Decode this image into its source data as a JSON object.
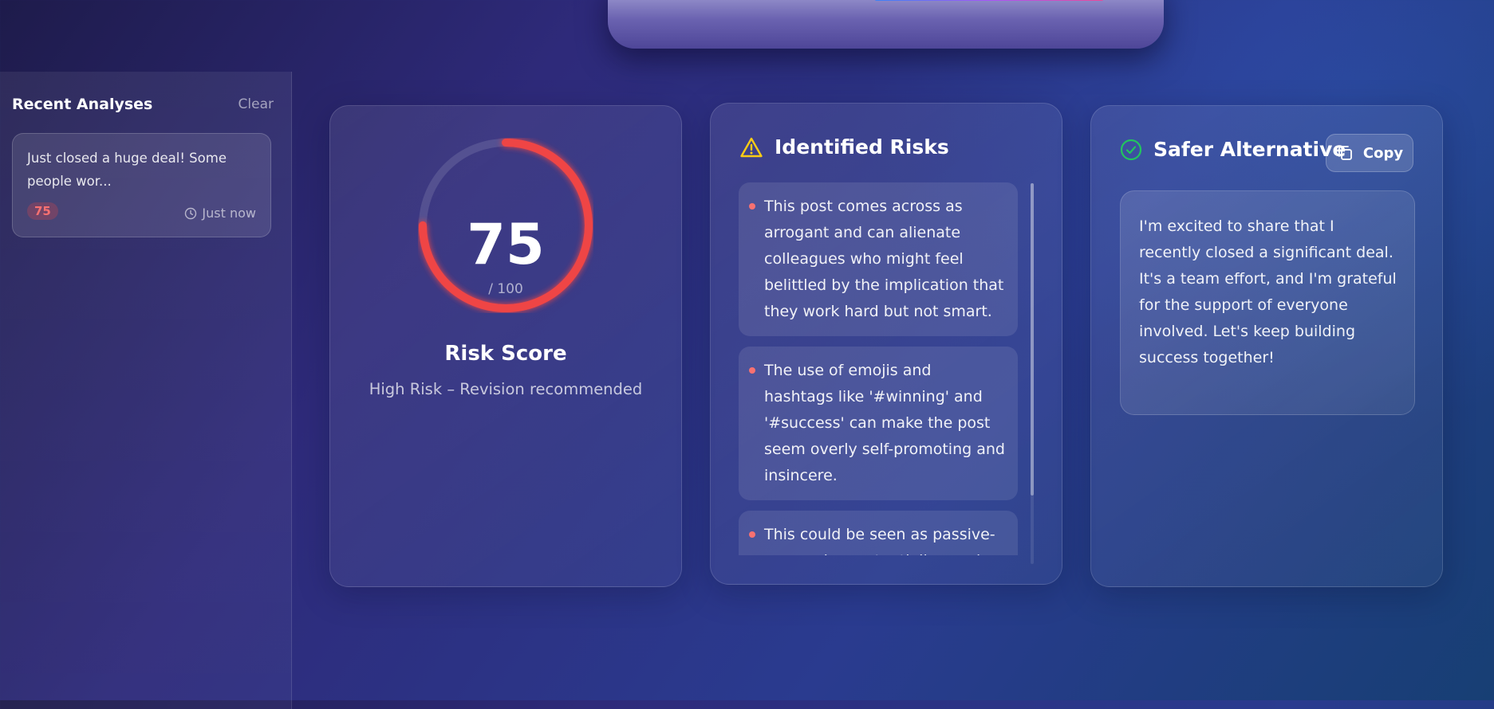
{
  "sidebar": {
    "title": "Recent Analyses",
    "clear_label": "Clear",
    "items": [
      {
        "text": "Just closed a huge deal! Some people wor...",
        "score": "75",
        "time": "Just now"
      }
    ]
  },
  "score_card": {
    "score": "75",
    "max_label": "/ 100",
    "score_value": 75,
    "score_max": 100,
    "title": "Risk Score",
    "subtitle": "High Risk – Revision recommended"
  },
  "risks_card": {
    "title": "Identified Risks",
    "items": [
      "This post comes across as arrogant and can alienate colleagues who might feel belittled by the implication that they work hard but not smart.",
      "The use of emojis and hashtags like '#winning' and '#success' can make the post seem overly self-promoting and insincere.",
      "This could be seen as passive-aggressive, potentially causing tension in the workplace."
    ]
  },
  "alt_card": {
    "title": "Safer Alternative",
    "copy_label": "Copy",
    "text": "I'm excited to share that I recently closed a significant deal. It's a team effort, and I'm grateful for the support of everyone involved. Let's keep building success together!"
  },
  "icons": {
    "warning": "warning-icon",
    "check": "check-circle-icon",
    "copy": "copy-icon",
    "clock": "clock-icon"
  },
  "colors": {
    "risk_red": "#ef4444",
    "warning_yellow": "#facc15",
    "success_green": "#22c55e"
  }
}
